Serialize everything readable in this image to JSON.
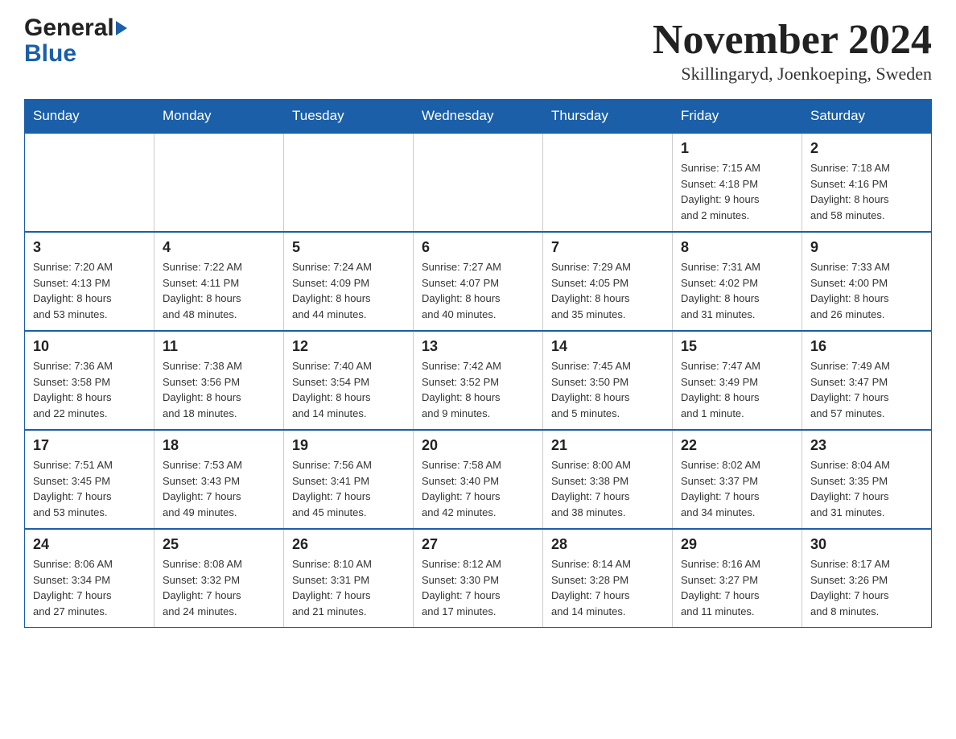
{
  "header": {
    "logo_general": "General",
    "logo_blue": "Blue",
    "title": "November 2024",
    "subtitle": "Skillingaryd, Joenkoeping, Sweden"
  },
  "weekdays": [
    "Sunday",
    "Monday",
    "Tuesday",
    "Wednesday",
    "Thursday",
    "Friday",
    "Saturday"
  ],
  "weeks": [
    [
      {
        "day": "",
        "info": ""
      },
      {
        "day": "",
        "info": ""
      },
      {
        "day": "",
        "info": ""
      },
      {
        "day": "",
        "info": ""
      },
      {
        "day": "",
        "info": ""
      },
      {
        "day": "1",
        "info": "Sunrise: 7:15 AM\nSunset: 4:18 PM\nDaylight: 9 hours\nand 2 minutes."
      },
      {
        "day": "2",
        "info": "Sunrise: 7:18 AM\nSunset: 4:16 PM\nDaylight: 8 hours\nand 58 minutes."
      }
    ],
    [
      {
        "day": "3",
        "info": "Sunrise: 7:20 AM\nSunset: 4:13 PM\nDaylight: 8 hours\nand 53 minutes."
      },
      {
        "day": "4",
        "info": "Sunrise: 7:22 AM\nSunset: 4:11 PM\nDaylight: 8 hours\nand 48 minutes."
      },
      {
        "day": "5",
        "info": "Sunrise: 7:24 AM\nSunset: 4:09 PM\nDaylight: 8 hours\nand 44 minutes."
      },
      {
        "day": "6",
        "info": "Sunrise: 7:27 AM\nSunset: 4:07 PM\nDaylight: 8 hours\nand 40 minutes."
      },
      {
        "day": "7",
        "info": "Sunrise: 7:29 AM\nSunset: 4:05 PM\nDaylight: 8 hours\nand 35 minutes."
      },
      {
        "day": "8",
        "info": "Sunrise: 7:31 AM\nSunset: 4:02 PM\nDaylight: 8 hours\nand 31 minutes."
      },
      {
        "day": "9",
        "info": "Sunrise: 7:33 AM\nSunset: 4:00 PM\nDaylight: 8 hours\nand 26 minutes."
      }
    ],
    [
      {
        "day": "10",
        "info": "Sunrise: 7:36 AM\nSunset: 3:58 PM\nDaylight: 8 hours\nand 22 minutes."
      },
      {
        "day": "11",
        "info": "Sunrise: 7:38 AM\nSunset: 3:56 PM\nDaylight: 8 hours\nand 18 minutes."
      },
      {
        "day": "12",
        "info": "Sunrise: 7:40 AM\nSunset: 3:54 PM\nDaylight: 8 hours\nand 14 minutes."
      },
      {
        "day": "13",
        "info": "Sunrise: 7:42 AM\nSunset: 3:52 PM\nDaylight: 8 hours\nand 9 minutes."
      },
      {
        "day": "14",
        "info": "Sunrise: 7:45 AM\nSunset: 3:50 PM\nDaylight: 8 hours\nand 5 minutes."
      },
      {
        "day": "15",
        "info": "Sunrise: 7:47 AM\nSunset: 3:49 PM\nDaylight: 8 hours\nand 1 minute."
      },
      {
        "day": "16",
        "info": "Sunrise: 7:49 AM\nSunset: 3:47 PM\nDaylight: 7 hours\nand 57 minutes."
      }
    ],
    [
      {
        "day": "17",
        "info": "Sunrise: 7:51 AM\nSunset: 3:45 PM\nDaylight: 7 hours\nand 53 minutes."
      },
      {
        "day": "18",
        "info": "Sunrise: 7:53 AM\nSunset: 3:43 PM\nDaylight: 7 hours\nand 49 minutes."
      },
      {
        "day": "19",
        "info": "Sunrise: 7:56 AM\nSunset: 3:41 PM\nDaylight: 7 hours\nand 45 minutes."
      },
      {
        "day": "20",
        "info": "Sunrise: 7:58 AM\nSunset: 3:40 PM\nDaylight: 7 hours\nand 42 minutes."
      },
      {
        "day": "21",
        "info": "Sunrise: 8:00 AM\nSunset: 3:38 PM\nDaylight: 7 hours\nand 38 minutes."
      },
      {
        "day": "22",
        "info": "Sunrise: 8:02 AM\nSunset: 3:37 PM\nDaylight: 7 hours\nand 34 minutes."
      },
      {
        "day": "23",
        "info": "Sunrise: 8:04 AM\nSunset: 3:35 PM\nDaylight: 7 hours\nand 31 minutes."
      }
    ],
    [
      {
        "day": "24",
        "info": "Sunrise: 8:06 AM\nSunset: 3:34 PM\nDaylight: 7 hours\nand 27 minutes."
      },
      {
        "day": "25",
        "info": "Sunrise: 8:08 AM\nSunset: 3:32 PM\nDaylight: 7 hours\nand 24 minutes."
      },
      {
        "day": "26",
        "info": "Sunrise: 8:10 AM\nSunset: 3:31 PM\nDaylight: 7 hours\nand 21 minutes."
      },
      {
        "day": "27",
        "info": "Sunrise: 8:12 AM\nSunset: 3:30 PM\nDaylight: 7 hours\nand 17 minutes."
      },
      {
        "day": "28",
        "info": "Sunrise: 8:14 AM\nSunset: 3:28 PM\nDaylight: 7 hours\nand 14 minutes."
      },
      {
        "day": "29",
        "info": "Sunrise: 8:16 AM\nSunset: 3:27 PM\nDaylight: 7 hours\nand 11 minutes."
      },
      {
        "day": "30",
        "info": "Sunrise: 8:17 AM\nSunset: 3:26 PM\nDaylight: 7 hours\nand 8 minutes."
      }
    ]
  ]
}
